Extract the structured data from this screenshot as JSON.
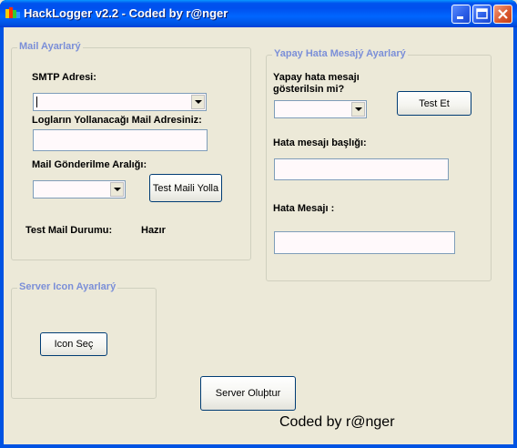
{
  "window": {
    "title": "HackLogger v2.2 - Coded by r@nger",
    "icon": "hacklogger-app-icon",
    "controls": [
      "minimize-icon",
      "maximize-icon",
      "close-icon"
    ]
  },
  "mail_group": {
    "title": "Mail Ayarlarý",
    "smtp_label": "SMTP Adresi:",
    "smtp_value": "",
    "recipient_label": "Logların Yollanacağı Mail Adresiniz:",
    "recipient_value": "",
    "interval_label": "Mail Gönderilme Aralığı:",
    "interval_value": "",
    "test_mail_button": "Test Maili Yolla",
    "status_label": "Test Mail Durumu:",
    "status_value": "Hazır"
  },
  "fake_error_group": {
    "title": "Yapay Hata Mesajý Ayarlarý",
    "show_label_line1": "Yapay hata mesajı",
    "show_label_line2": "gösterilsin mi?",
    "show_value": "",
    "test_button": "Test Et",
    "error_title_label": "Hata mesajı başlığı:",
    "error_title_value": "",
    "error_message_label": "Hata Mesajı :",
    "error_message_value": ""
  },
  "icon_group": {
    "title": "Server Icon Ayarlarý",
    "select_icon_button": "Icon Seç"
  },
  "create_server_button": "Server Oluþtur",
  "credit": "Coded by r@nger",
  "colors": {
    "titlebar": "#0053ee",
    "group_title": "#7b8fd8",
    "input_bg": "#fff9fb",
    "window_bg": "#ece9d8"
  }
}
